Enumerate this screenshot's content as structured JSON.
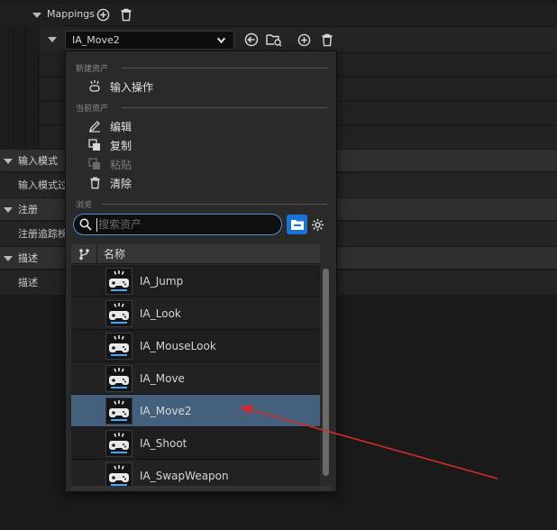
{
  "mappings": {
    "label": "Mappings"
  },
  "mapping_row": {
    "selected_asset": "IA_Move2"
  },
  "categories": [
    {
      "label": "输入模式",
      "prop": "输入模式过"
    },
    {
      "label": "注册",
      "prop": "注册追踪榜"
    },
    {
      "label": "描述",
      "prop": "描述"
    }
  ],
  "popup": {
    "new_asset_header": "新建资产",
    "new_input_action": "输入操作",
    "current_asset_header": "当前资产",
    "edit": "编辑",
    "copy": "复制",
    "paste": "粘贴",
    "clear": "清除",
    "browse_header": "浏览",
    "search_placeholder": "搜索资产",
    "column_name": "名称",
    "items": [
      "IA_Jump",
      "IA_Look",
      "IA_MouseLook",
      "IA_Move",
      "IA_Move2",
      "IA_Shoot",
      "IA_SwapWeapon"
    ],
    "selected_item": "IA_Move2"
  },
  "colors": {
    "selection": "#45607d",
    "accent": "#1a74d8",
    "annotation_arrow": "#d62b2b"
  },
  "icons": [
    "add-icon",
    "trash-icon",
    "chevron-down-icon",
    "browse-back-icon",
    "browse-folder-icon",
    "input-action-icon",
    "edit-pencil-icon",
    "copy-icon",
    "paste-icon",
    "search-icon",
    "folder-icon",
    "settings-gear-icon",
    "hierarchy-icon",
    "gamepad-icon"
  ]
}
